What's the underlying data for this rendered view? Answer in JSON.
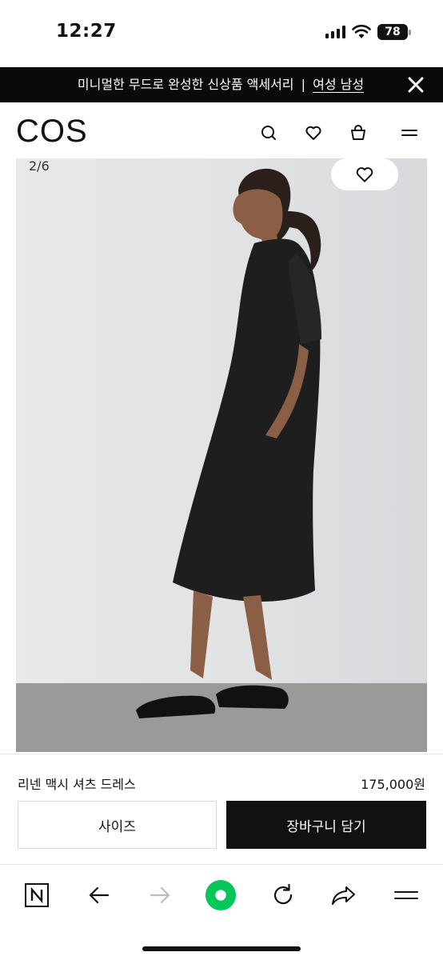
{
  "status_bar": {
    "time": "12:27",
    "battery": "78",
    "icons": [
      "signal-icon",
      "wifi-icon",
      "battery-icon"
    ]
  },
  "promo": {
    "text": "미니멀한 무드로 완성한 신상품 액세서리",
    "separator": "|",
    "link_label": "여성 남성",
    "close_icon": "close-icon"
  },
  "header": {
    "logo": "COS",
    "icons": [
      "search-icon",
      "heart-icon",
      "bag-icon",
      "menu-icon"
    ]
  },
  "gallery": {
    "counter": "2/6",
    "current": 2,
    "total": 6,
    "wishlist_icon": "heart-icon"
  },
  "product": {
    "name": "리넨 맥시 셔츠 드레스",
    "price": "175,000원",
    "size_button": "사이즈",
    "cart_button": "장바구니 담기"
  },
  "browser_toolbar": {
    "icons": [
      "naver-n-icon",
      "back-arrow-icon",
      "forward-arrow-icon",
      "green-dot-home-icon",
      "reload-icon",
      "share-icon",
      "menu-lines-icon"
    ],
    "accent": "#03c75a"
  }
}
